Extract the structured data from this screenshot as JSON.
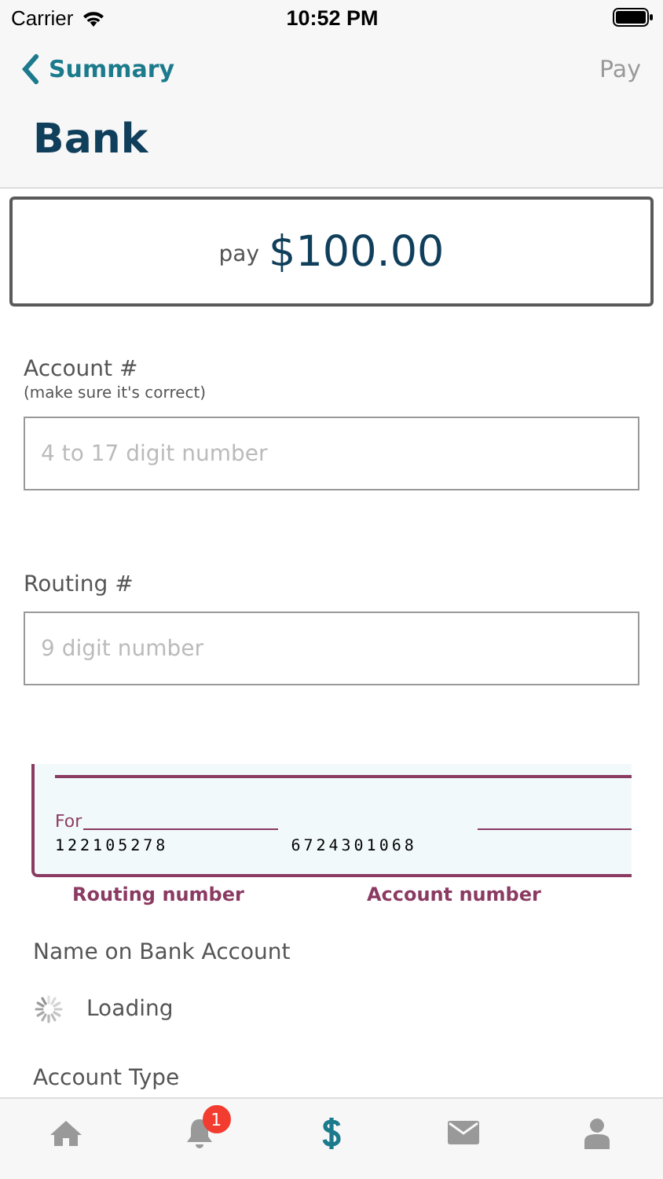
{
  "status_bar": {
    "carrier": "Carrier",
    "time": "10:52 PM"
  },
  "nav": {
    "back_label": "Summary",
    "action": "Pay",
    "title": "Bank"
  },
  "amount": {
    "prefix": "pay",
    "value": "$100.00"
  },
  "fields": [
    {
      "label": "Account #",
      "hint": "(make sure it's correct)",
      "placeholder": "4 to 17 digit number"
    },
    {
      "label": "Routing #",
      "placeholder": "9 digit number"
    }
  ],
  "check": {
    "for_label": "For",
    "routing_digits": "122105278",
    "account_digits": "6724301068",
    "routing_caption": "Routing number",
    "account_caption": "Account number"
  },
  "name_section": {
    "label": "Name on Bank Account",
    "status": "Loading"
  },
  "next_section": {
    "label": "Account Type"
  },
  "tabs": [
    {
      "kind": "home",
      "selected": false
    },
    {
      "kind": "bell",
      "selected": false,
      "badge": "1"
    },
    {
      "kind": "dollar",
      "selected": true
    },
    {
      "kind": "mail",
      "selected": false
    },
    {
      "kind": "person",
      "selected": false
    }
  ]
}
